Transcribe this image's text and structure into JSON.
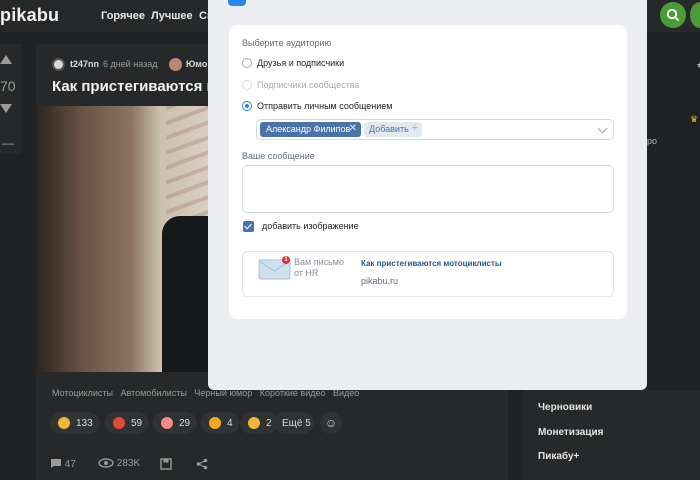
{
  "header": {
    "logo": "pikabu",
    "nav": [
      "Горячее",
      "Лучшее",
      "Св"
    ]
  },
  "rail": {
    "rating": "70",
    "dash": "—"
  },
  "post": {
    "author": "t247nn",
    "time": "6 дней назад",
    "community": "Юмо",
    "title": "Как пристегиваются мот",
    "tags": [
      "Мотоциклисты",
      "Автомобилисты",
      "Черный юмор",
      "Короткие видео",
      "Видео"
    ],
    "reactions": [
      {
        "count": "133",
        "color": "#f3b53b"
      },
      {
        "count": "59",
        "color": "#e04a3a"
      },
      {
        "count": "29",
        "color": "#f28c8c"
      },
      {
        "count": "4",
        "color": "#f5a623"
      },
      {
        "count": "2",
        "color": "#f3b53b"
      }
    ],
    "more_reactions": "Ещё 5",
    "comments": "47",
    "views": "283K"
  },
  "sidebar": {
    "items": [
      "Черновики",
      "Монетизация",
      "Пикабу+"
    ],
    "frag_ro": "ро"
  },
  "share_modal": {
    "audience_label": "Выберите аудиторию",
    "options": [
      {
        "label": "Друзья и подписчики",
        "state": "unchecked"
      },
      {
        "label": "Подписчики сообщества",
        "state": "disabled"
      },
      {
        "label": "Отправить личным сообщением",
        "state": "checked"
      }
    ],
    "recipient": "Александр Филипов",
    "add_label": "Добавить",
    "message_label": "Ваше сообщение",
    "message_value": "",
    "attach_label": "добавить изображение",
    "attachment": {
      "badge": "1",
      "thumb_text": "Вам письмо от HR",
      "title": "Как пристегиваются мотоциклисты",
      "domain": "pikabu.ru"
    }
  },
  "colors": {
    "accent": "#2688eb",
    "chip": "#4a74a8",
    "link": "#2a5885",
    "green": "#4b9b3b"
  }
}
